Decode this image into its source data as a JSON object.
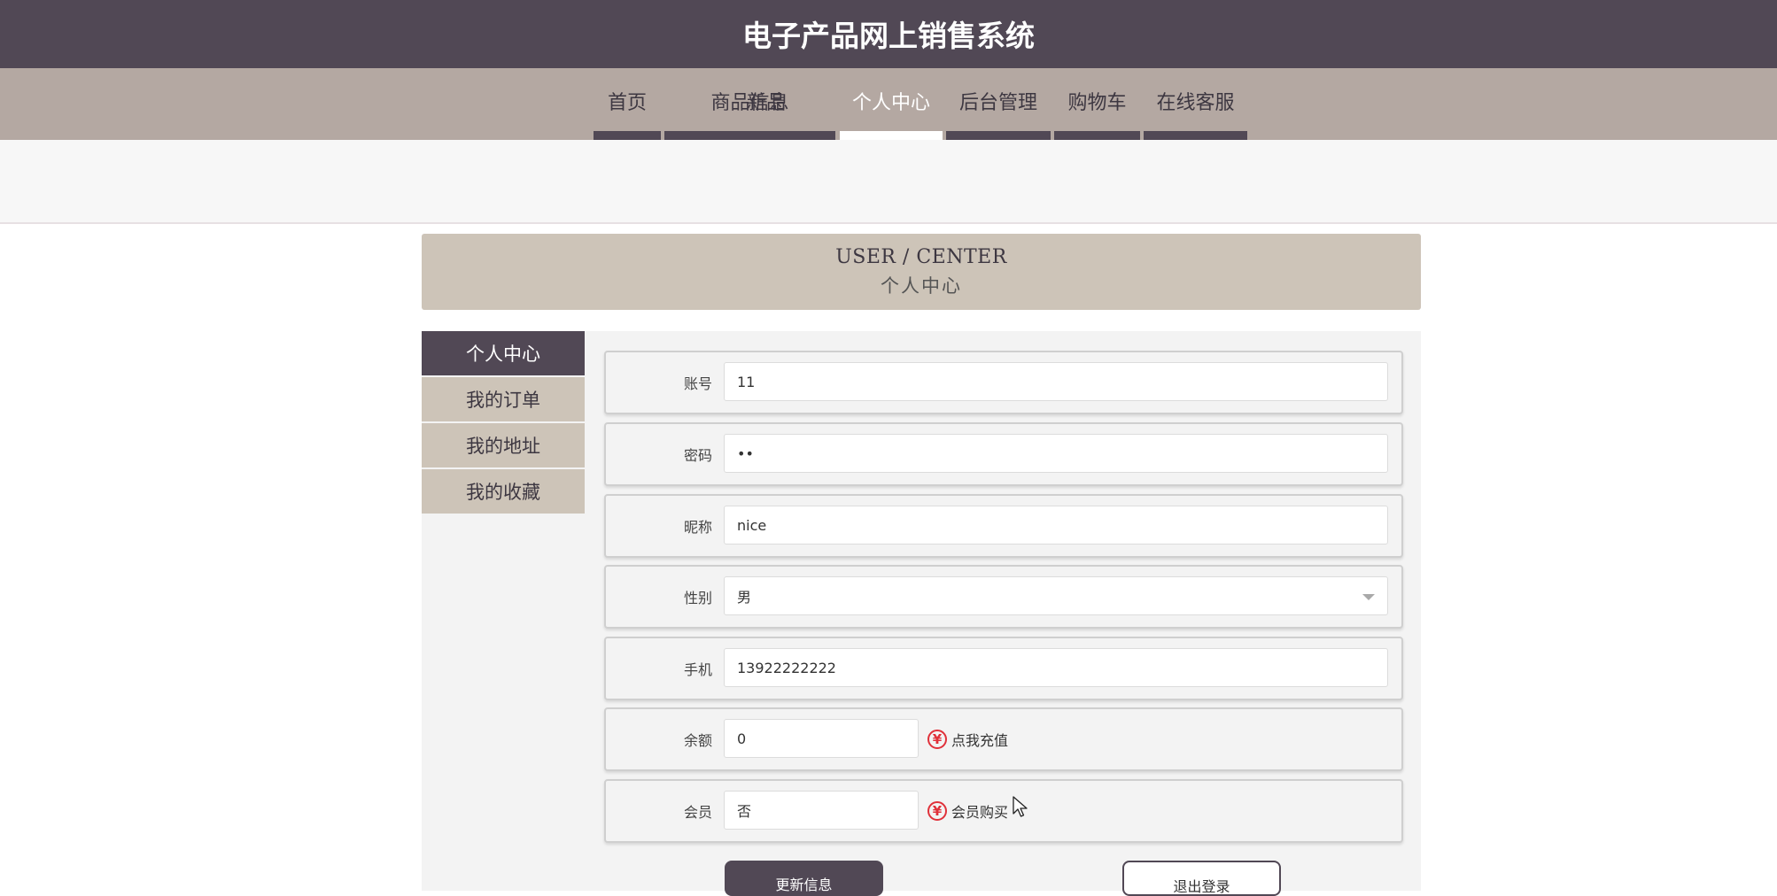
{
  "header": {
    "title": "电子产品网上销售系统"
  },
  "nav": {
    "items": [
      {
        "label": "首页"
      },
      {
        "label": "商品信息"
      },
      {
        "label": "新品"
      },
      {
        "label": "个人中心"
      },
      {
        "label": "后台管理"
      },
      {
        "label": "购物车"
      },
      {
        "label": "在线客服"
      }
    ],
    "active_index": 3
  },
  "section": {
    "title_en": "USER / CENTER",
    "title_cn": "个人中心"
  },
  "sidebar": {
    "items": [
      {
        "label": "个人中心"
      },
      {
        "label": "我的订单"
      },
      {
        "label": "我的地址"
      },
      {
        "label": "我的收藏"
      }
    ],
    "active_index": 0
  },
  "form": {
    "account": {
      "label": "账号",
      "value": "11"
    },
    "password": {
      "label": "密码",
      "value": "••"
    },
    "nickname": {
      "label": "昵称",
      "value": "nice"
    },
    "gender": {
      "label": "性别",
      "value": "男"
    },
    "phone": {
      "label": "手机",
      "value": "13922222222"
    },
    "balance": {
      "label": "余额",
      "value": "0",
      "link": "点我充值"
    },
    "member": {
      "label": "会员",
      "value": "否",
      "link": "会员购买"
    }
  },
  "icons": {
    "currency": "¥"
  },
  "buttons": {
    "update": "更新信息",
    "logout": "退出登录"
  },
  "colors": {
    "header_bg": "#514855",
    "nav_bg": "#b4a8a2",
    "accent_beige": "#cdc4b8",
    "icon_red": "#e0313a"
  }
}
